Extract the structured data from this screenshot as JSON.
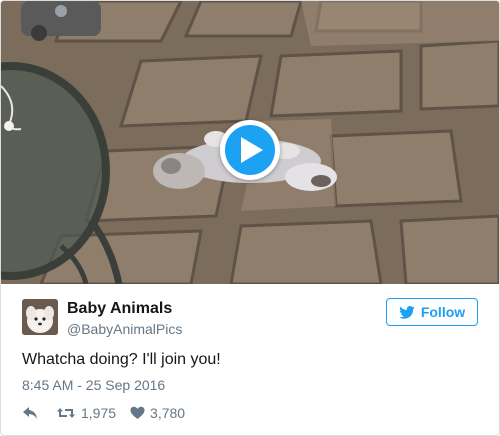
{
  "media": {
    "kind": "video",
    "play_icon": "play-icon",
    "accent_color": "#1da1f2"
  },
  "tweet": {
    "author_name": "Baby Animals",
    "author_handle": "@BabyAnimalPics",
    "follow_label": "Follow",
    "follow_icon": "twitter-bird-icon",
    "text": "Whatcha doing? I'll join you!",
    "timestamp": "8:45 AM - 25 Sep 2016",
    "retweet_count": "1,975",
    "like_count": "3,780",
    "icons": [
      "reply-icon",
      "retweet-icon",
      "heart-icon"
    ]
  }
}
